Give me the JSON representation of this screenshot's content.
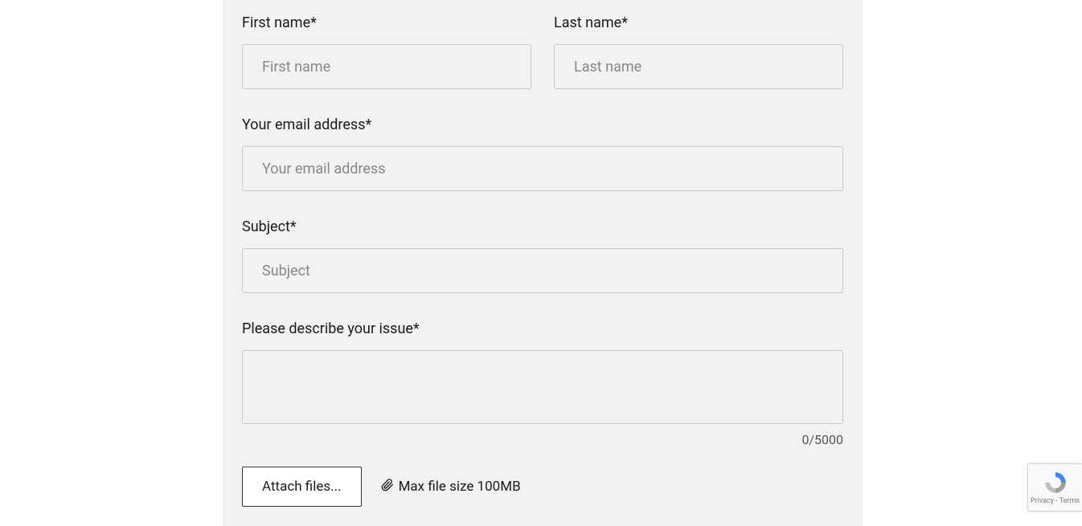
{
  "form": {
    "first_name": {
      "label": "First name*",
      "placeholder": "First name",
      "value": ""
    },
    "last_name": {
      "label": "Last name*",
      "placeholder": "Last name",
      "value": ""
    },
    "email": {
      "label": "Your email address*",
      "placeholder": "Your email address",
      "value": ""
    },
    "subject": {
      "label": "Subject*",
      "placeholder": "Subject",
      "value": ""
    },
    "description": {
      "label": "Please describe your issue*",
      "placeholder": "",
      "value": ""
    },
    "counter": "0/5000",
    "attach": {
      "button_label": "Attach files...",
      "max_size_text": "Max file size 100MB"
    }
  },
  "recaptcha": {
    "privacy": "Privacy",
    "sep": " - ",
    "terms": "Terms"
  }
}
